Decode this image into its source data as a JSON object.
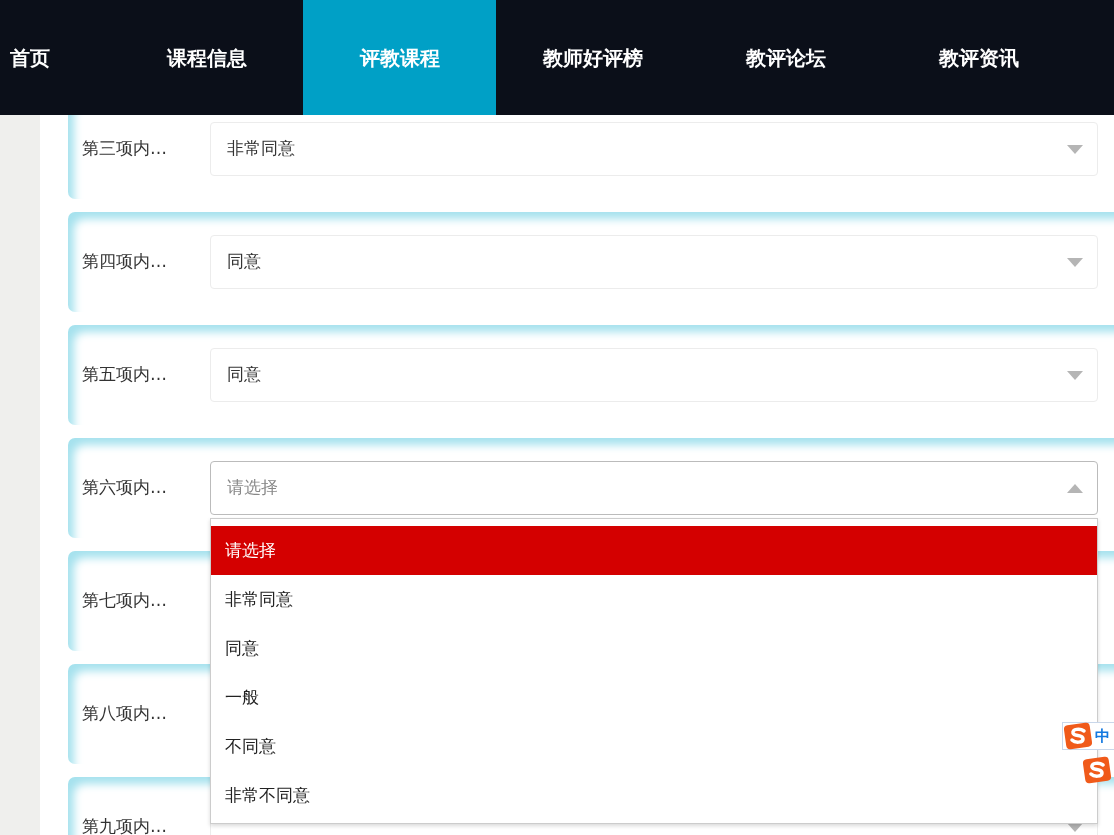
{
  "nav": [
    {
      "label": "首页",
      "selected": false
    },
    {
      "label": "课程信息",
      "selected": false
    },
    {
      "label": "评教课程",
      "selected": true
    },
    {
      "label": "教师好评榜",
      "selected": false
    },
    {
      "label": "教评论坛",
      "selected": false
    },
    {
      "label": "教评资讯",
      "selected": false
    }
  ],
  "questions": [
    {
      "label": "第三项内…",
      "value": "非常同意",
      "open": false
    },
    {
      "label": "第四项内…",
      "value": "同意",
      "open": false
    },
    {
      "label": "第五项内…",
      "value": "同意",
      "open": false
    },
    {
      "label": "第六项内…",
      "placeholder": "请选择",
      "open": true
    },
    {
      "label": "第七项内…"
    },
    {
      "label": "第八项内…"
    },
    {
      "label": "第九项内…",
      "open": false
    }
  ],
  "dropdown_options": [
    {
      "label": "请选择",
      "selected": true
    },
    {
      "label": "非常同意",
      "selected": false
    },
    {
      "label": "同意",
      "selected": false
    },
    {
      "label": "一般",
      "selected": false
    },
    {
      "label": "不同意",
      "selected": false
    },
    {
      "label": "非常不同意",
      "selected": false
    }
  ],
  "ime_toolbar": {
    "mode": "中"
  }
}
